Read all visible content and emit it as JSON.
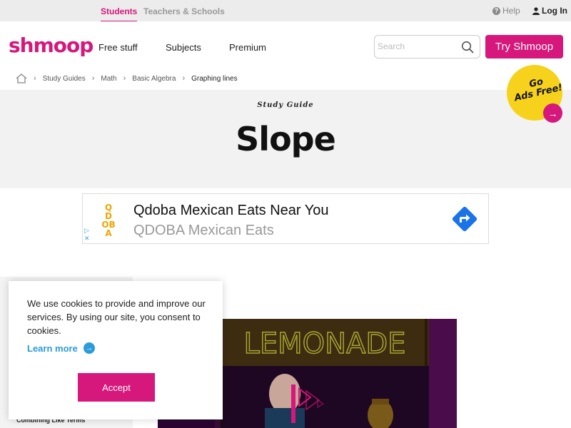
{
  "topbar": {
    "students": "Students",
    "teachers": "Teachers & Schools",
    "help": "Help",
    "login": "Log In"
  },
  "header": {
    "logo": "shmoop",
    "nav": [
      "Free stuff",
      "Subjects",
      "Premium"
    ],
    "search_placeholder": "Search",
    "try_button": "Try Shmoop"
  },
  "breadcrumb": [
    "Study Guides",
    "Math",
    "Basic Algebra",
    "Graphing lines"
  ],
  "hero": {
    "kicker": "Study Guide",
    "title": "Slope"
  },
  "badge": {
    "line1": "Go",
    "line2": "Ads Free!"
  },
  "ad": {
    "logo": "QDOBA",
    "title": "Qdoba Mexican Eats Near You",
    "subtitle": "QDOBA Mexican Eats"
  },
  "sidebar": {
    "item": "Combining Like Terms"
  },
  "video": {
    "sign_text": "LEMONADE"
  },
  "cookie": {
    "message": "We use cookies to provide and improve our services. By using our site, you consent to cookies.",
    "learn_more": "Learn more",
    "accept": "Accept"
  },
  "colors": {
    "brand": "#d6177b",
    "badge": "#f6d21c",
    "link": "#2a9bdb"
  }
}
